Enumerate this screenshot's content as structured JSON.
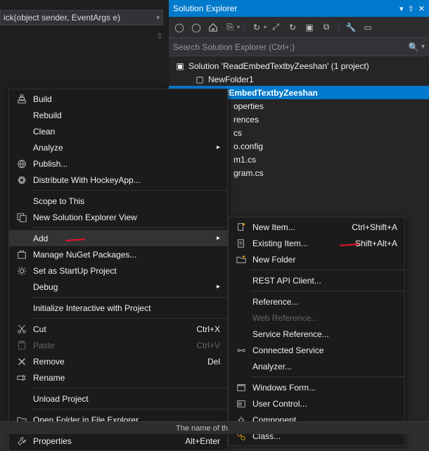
{
  "editor_dropdown": "ick(object sender, EventArgs e)",
  "solution_explorer": {
    "title": "Solution Explorer",
    "search_placeholder": "Search Solution Explorer (Ctrl+;)",
    "tree": {
      "solution": "Solution 'ReadEmbedTextbyZeeshan' (1 project)",
      "folder": "NewFolder1",
      "project": "ReadEmbedTextbyZeeshan",
      "children": [
        "operties",
        "rences",
        "cs",
        "o.config",
        "m1.cs",
        "gram.cs"
      ]
    }
  },
  "context_menu": [
    {
      "icon": "build-icon",
      "label": "Build"
    },
    {
      "label": "Rebuild"
    },
    {
      "label": "Clean"
    },
    {
      "label": "Analyze",
      "submenu": true
    },
    {
      "icon": "publish-icon",
      "label": "Publish..."
    },
    {
      "icon": "hockey-icon",
      "label": "Distribute With HockeyApp..."
    },
    {
      "sep": true
    },
    {
      "label": "Scope to This"
    },
    {
      "icon": "newview-icon",
      "label": "New Solution Explorer View"
    },
    {
      "sep": true
    },
    {
      "label": "Add",
      "submenu": true,
      "hover": true,
      "redmark": true
    },
    {
      "icon": "nuget-icon",
      "label": "Manage NuGet Packages..."
    },
    {
      "icon": "gear-icon",
      "label": "Set as StartUp Project"
    },
    {
      "label": "Debug",
      "submenu": true
    },
    {
      "sep": true
    },
    {
      "label": "Initialize Interactive with Project"
    },
    {
      "sep": true
    },
    {
      "icon": "cut-icon",
      "label": "Cut",
      "shortcut": "Ctrl+X"
    },
    {
      "icon": "paste-icon",
      "label": "Paste",
      "shortcut": "Ctrl+V",
      "disabled": true
    },
    {
      "icon": "remove-icon",
      "label": "Remove",
      "shortcut": "Del"
    },
    {
      "icon": "rename-icon",
      "label": "Rename"
    },
    {
      "sep": true
    },
    {
      "label": "Unload Project"
    },
    {
      "sep": true
    },
    {
      "icon": "folder-icon",
      "label": "Open Folder in File Explorer"
    },
    {
      "sep": true
    },
    {
      "icon": "wrench-icon",
      "label": "Properties",
      "shortcut": "Alt+Enter"
    }
  ],
  "add_submenu": [
    {
      "icon": "newitem-icon",
      "label": "New Item...",
      "shortcut": "Ctrl+Shift+A"
    },
    {
      "icon": "existing-icon",
      "label": "Existing Item...",
      "shortcut": "Shift+Alt+A",
      "redmark": true
    },
    {
      "icon": "newfolder-icon",
      "label": "New Folder"
    },
    {
      "sep": true
    },
    {
      "label": "REST API Client..."
    },
    {
      "sep": true
    },
    {
      "label": "Reference..."
    },
    {
      "label": "Web Reference...",
      "disabled": true
    },
    {
      "label": "Service Reference..."
    },
    {
      "icon": "connsvc-icon",
      "label": "Connected Service"
    },
    {
      "label": "Analyzer..."
    },
    {
      "sep": true
    },
    {
      "icon": "form-icon",
      "label": "Windows Form..."
    },
    {
      "icon": "uc-icon",
      "label": "User Control..."
    },
    {
      "icon": "comp-icon",
      "label": "Component..."
    },
    {
      "icon": "class-icon",
      "label": "Class..."
    }
  ],
  "status_text": "The name of th"
}
